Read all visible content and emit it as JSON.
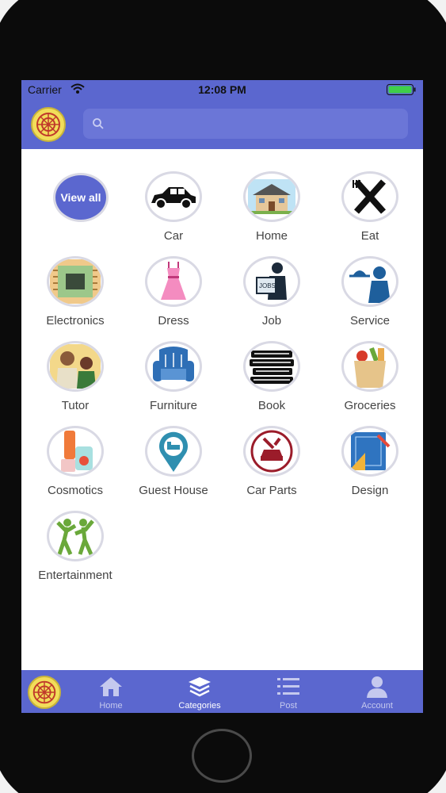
{
  "status_bar": {
    "carrier": "Carrier",
    "time": "12:08 PM"
  },
  "search": {
    "placeholder": ""
  },
  "view_all_label": "View all",
  "categories": [
    {
      "label": "Car",
      "icon": "car-icon"
    },
    {
      "label": "Home",
      "icon": "house-icon"
    },
    {
      "label": "Eat",
      "icon": "fork-knife-icon"
    },
    {
      "label": "Electronics",
      "icon": "chip-icon"
    },
    {
      "label": "Dress",
      "icon": "dress-icon"
    },
    {
      "label": "Job",
      "icon": "job-icon"
    },
    {
      "label": "Service",
      "icon": "waiter-icon"
    },
    {
      "label": "Tutor",
      "icon": "tutor-icon"
    },
    {
      "label": "Furniture",
      "icon": "armchair-icon"
    },
    {
      "label": "Book",
      "icon": "books-icon"
    },
    {
      "label": "Groceries",
      "icon": "grocery-bag-icon"
    },
    {
      "label": "Cosmotics",
      "icon": "cosmetics-icon"
    },
    {
      "label": "Guest House",
      "icon": "guest-house-pin-icon"
    },
    {
      "label": "Car Parts",
      "icon": "car-parts-icon"
    },
    {
      "label": "Design",
      "icon": "design-icon"
    },
    {
      "label": "Entertainment",
      "icon": "dancers-icon"
    }
  ],
  "tabs": [
    {
      "label": "Home",
      "icon": "home-icon"
    },
    {
      "label": "Categories",
      "icon": "layers-icon"
    },
    {
      "label": "Post",
      "icon": "list-icon"
    },
    {
      "label": "Account",
      "icon": "user-icon"
    }
  ],
  "colors": {
    "brand": "#5b67cf",
    "background": "#ffffff",
    "text": "#444444"
  }
}
